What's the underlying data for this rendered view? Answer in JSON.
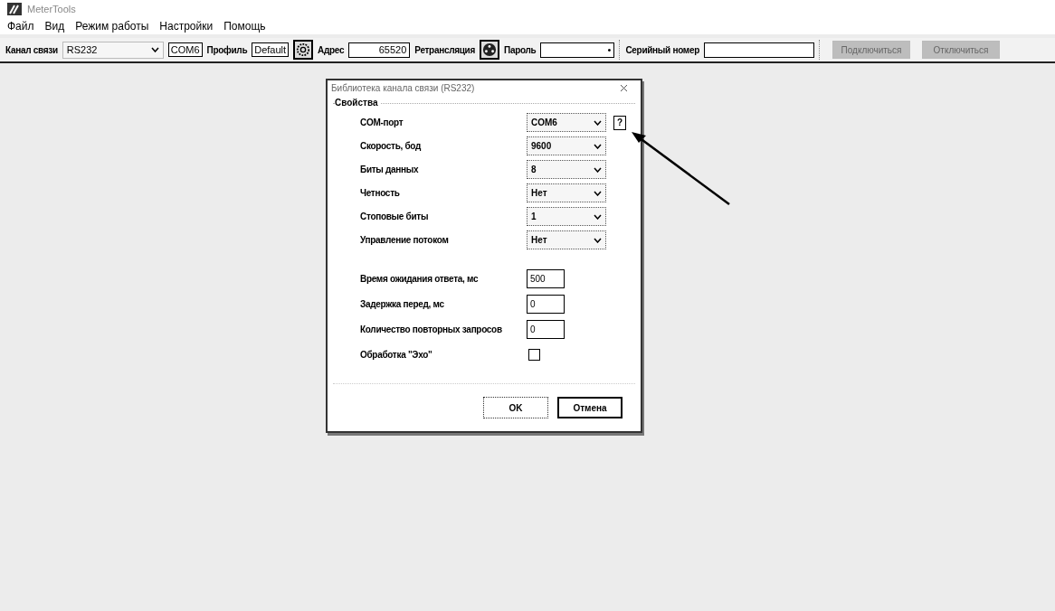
{
  "window": {
    "title": "MeterTools"
  },
  "menu": [
    "Файл",
    "Вид",
    "Режим работы",
    "Настройки",
    "Помощь"
  ],
  "toolbar": {
    "channel": {
      "label": "Канал связи",
      "value": "RS232"
    },
    "port": "COM6",
    "profile": {
      "label": "Профиль",
      "value": "Default"
    },
    "address": {
      "label": "Адрес",
      "value": "65520"
    },
    "relay": {
      "label": "Ретрансляция"
    },
    "password": {
      "label": "Пароль",
      "value": "•"
    },
    "serial": {
      "label": "Серийный номер"
    },
    "buttons": [
      {
        "label": "Подключиться",
        "disabled": true
      },
      {
        "label": "Отключиться",
        "disabled": true
      }
    ]
  },
  "dialog": {
    "title": "Библиотека канала связи (RS232)",
    "group": "Свойства",
    "fields": [
      {
        "kind": "select",
        "label": "COM-порт",
        "value": "COM6",
        "help": "?"
      },
      {
        "kind": "select",
        "label": "Скорость, бод",
        "value": "9600"
      },
      {
        "kind": "select",
        "label": "Биты данных",
        "value": "8"
      },
      {
        "kind": "select",
        "label": "Четность",
        "value": "Нет"
      },
      {
        "kind": "select",
        "label": "Стоповые биты",
        "value": "1"
      },
      {
        "kind": "select",
        "label": "Управление потоком",
        "value": "Нет"
      },
      {
        "kind": "input",
        "label": "Время ожидания ответа, мс",
        "value": "500"
      },
      {
        "kind": "input",
        "label": "Задержка перед, мс",
        "value": "0"
      },
      {
        "kind": "input",
        "label": "Количество повторных запросов",
        "value": "0"
      },
      {
        "kind": "checkbox",
        "label": "Обработка \"Эхо\"",
        "checked": false
      }
    ],
    "buttons": [
      "OK",
      "Отмена"
    ]
  }
}
